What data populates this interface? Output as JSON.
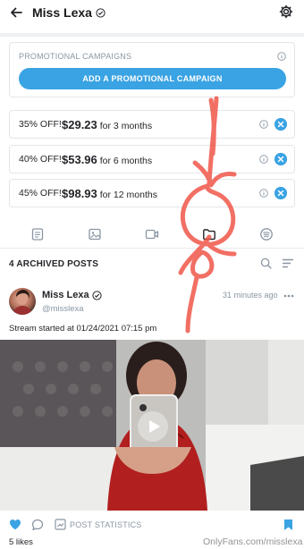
{
  "header": {
    "title": "Miss Lexa"
  },
  "promo": {
    "label": "PROMOTIONAL CAMPAIGNS",
    "button": "ADD A PROMOTIONAL CAMPAIGN"
  },
  "offers": [
    {
      "percent": "35% OFF!",
      "price": "$29.23",
      "period": "for 3 months"
    },
    {
      "percent": "40% OFF!",
      "price": "$53.96",
      "period": "for 6 months"
    },
    {
      "percent": "45% OFF!",
      "price": "$98.93",
      "period": "for 12 months"
    }
  ],
  "tabs": [
    "posts-icon",
    "photos-icon",
    "videos-icon",
    "archive-folder-icon",
    "audio-icon"
  ],
  "archived": {
    "label": "4 ARCHIVED POSTS"
  },
  "post": {
    "name": "Miss Lexa",
    "handle": "@misslexa",
    "time": "31 minutes ago",
    "text": "Stream started at 01/24/2021 07:15 pm",
    "stats_label": "POST STATISTICS",
    "likes": "5 likes"
  },
  "watermark": "OnlyFans.com/misslexa",
  "colors": {
    "accent": "#3aa3e3",
    "muted": "#8a96a3",
    "scribble": "#f0564a"
  }
}
